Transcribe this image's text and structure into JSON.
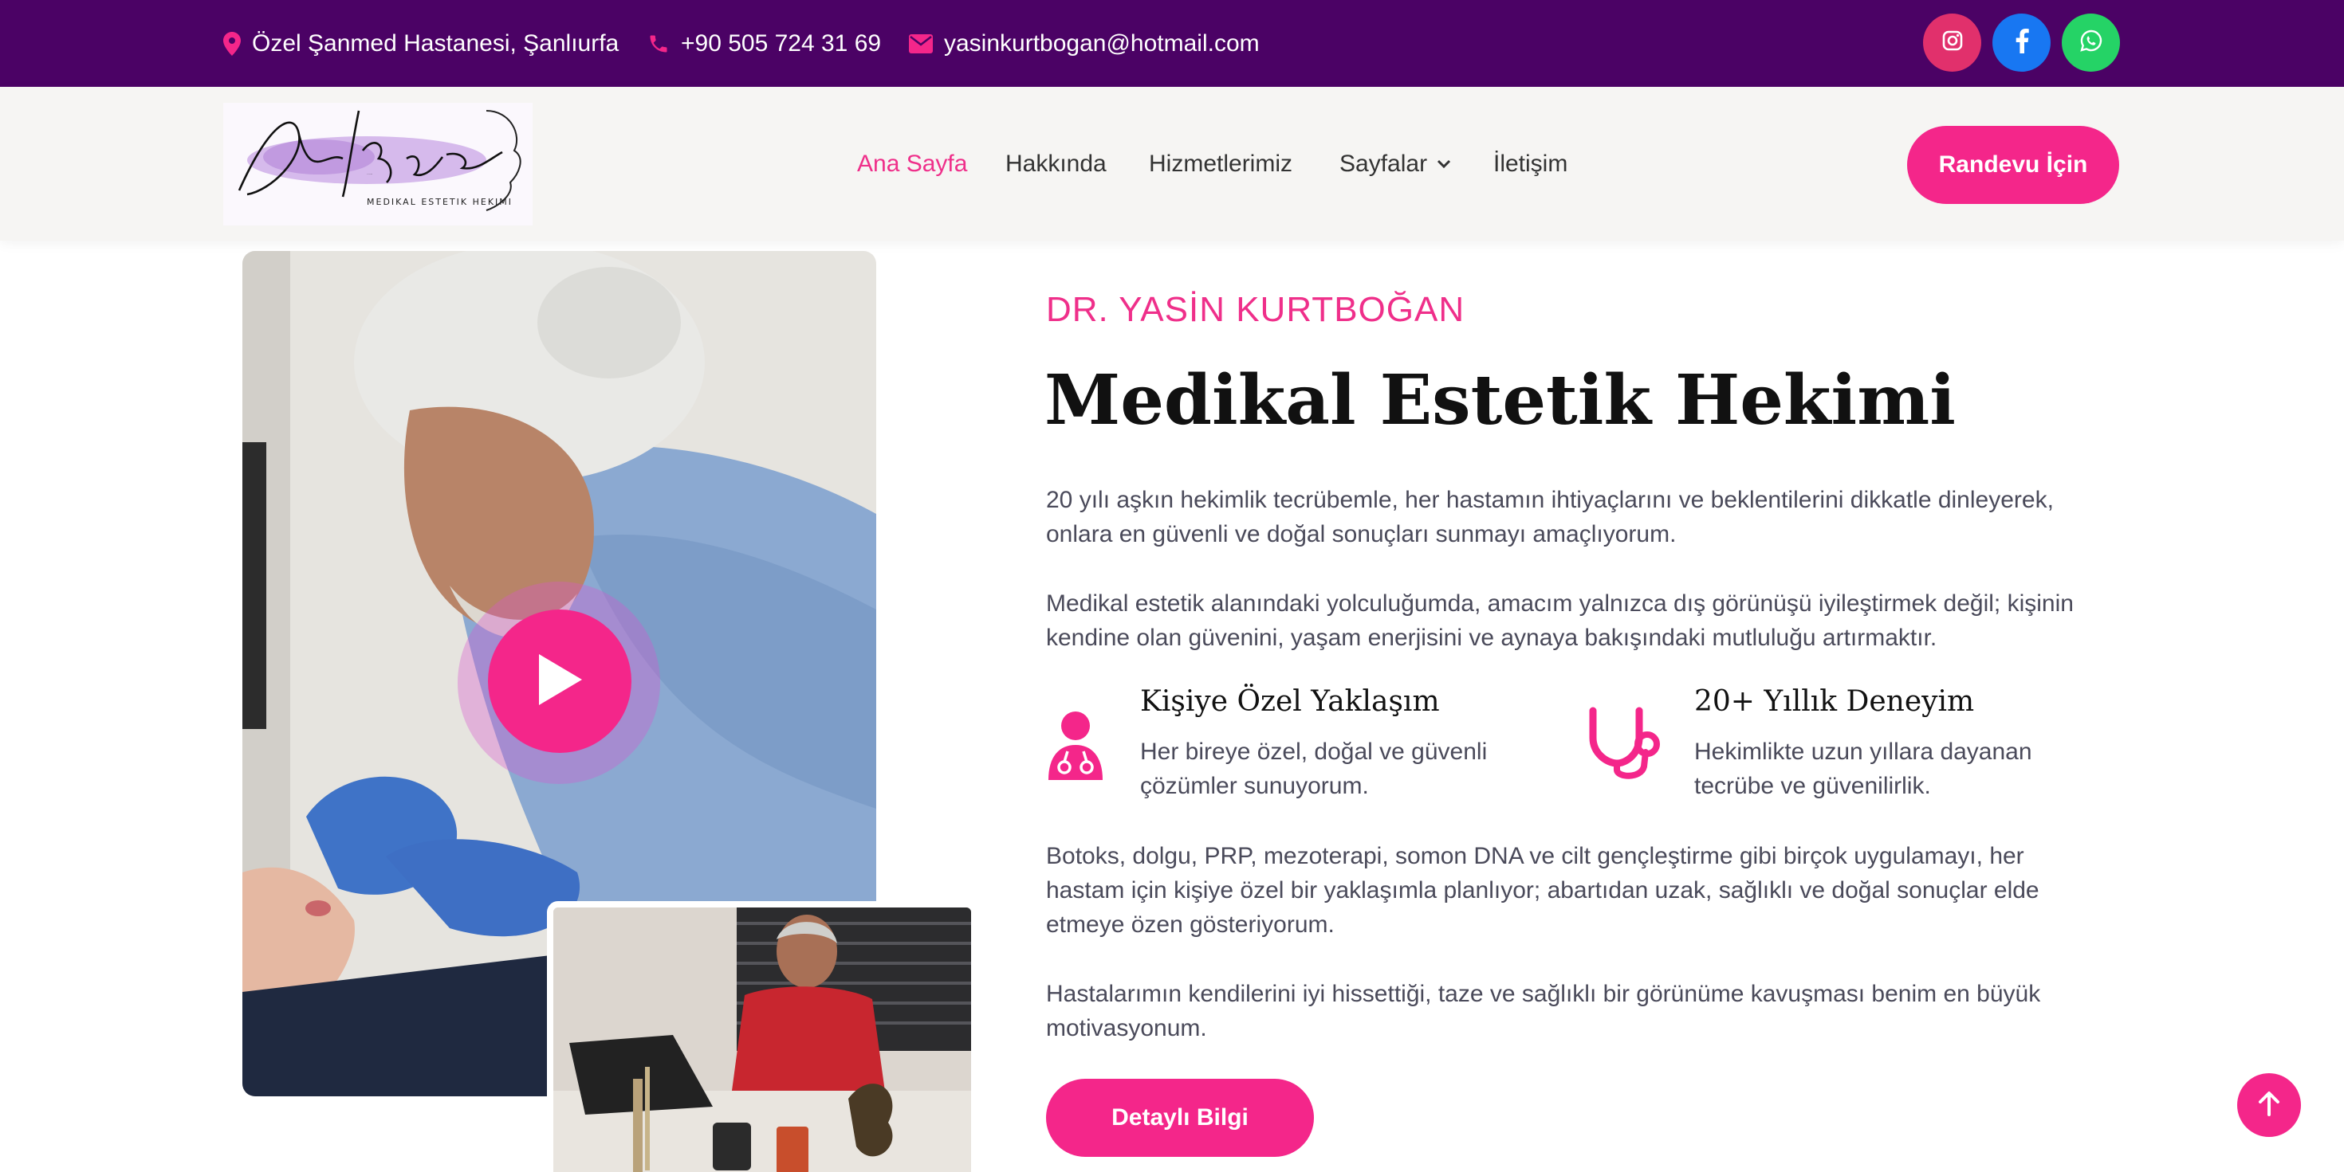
{
  "topbar": {
    "address": "Özel Şanmed Hastanesi, Şanlıurfa",
    "phone": "+90 505 724 31 69",
    "email": "yasinkurtbogan@hotmail.com",
    "social": [
      {
        "name": "instagram-icon",
        "color": "#e1306c"
      },
      {
        "name": "facebook-icon",
        "color": "#1877f2"
      },
      {
        "name": "whatsapp-icon",
        "color": "#25d366"
      }
    ]
  },
  "logo": {
    "script_text": "Dr. Kurtboğan",
    "subtitle": "MEDIKAL ESTETIK HEKIMI"
  },
  "nav": {
    "items": [
      {
        "label": "Ana Sayfa",
        "active": true
      },
      {
        "label": "Hakkında"
      },
      {
        "label": "Hizmetlerimiz"
      },
      {
        "label": "Sayfalar"
      },
      {
        "label": "İletişim"
      }
    ],
    "cta": "Randevu İçin"
  },
  "about": {
    "eyebrow": "DR. YASİN KURTBOĞAN",
    "title": "Medikal Estetik Hekimi",
    "para1": "20 yılı aşkın hekimlik tecrübemle, her hastamın ihtiyaçlarını ve beklentilerini dikkatle dinleyerek, onlara en güvenli ve doğal sonuçları sunmayı amaçlıyorum.",
    "para2": "Medikal estetik alanındaki yolculuğumda, amacım yalnızca dış görünüşü iyileştirmek değil; kişinin kendine olan güvenini, yaşam enerjisini ve aynaya bakışındaki mutluluğu artırmaktır.",
    "features": [
      {
        "title": "Kişiye Özel Yaklaşım",
        "text": "Her bireye özel, doğal ve güvenli çözümler sunuyorum.",
        "icon": "doctor-icon"
      },
      {
        "title": "20+ Yıllık Deneyim",
        "text": "Hekimlikte uzun yıllara dayanan tecrübe ve güvenilirlik.",
        "icon": "stethoscope-icon"
      }
    ],
    "para3": "Botoks, dolgu, PRP, mezoterapi, somon DNA ve cilt gençleştirme gibi birçok uygulamayı, her hastam için kişiye özel bir yaklaşımla planlıyor; abartıdan uzak, sağlıklı ve doğal sonuçlar elde etmeye özen gösteriyorum.",
    "para4": "Hastalarımın kendilerini iyi hissettiği, taze ve sağlıklı bir görünüme kavuşması benim en büyük motivasyonum.",
    "button": "Detaylı Bilgi"
  },
  "colors": {
    "topbar": "#4b0265",
    "accent": "#f4268a",
    "nav_bg": "#f6f5f3"
  }
}
